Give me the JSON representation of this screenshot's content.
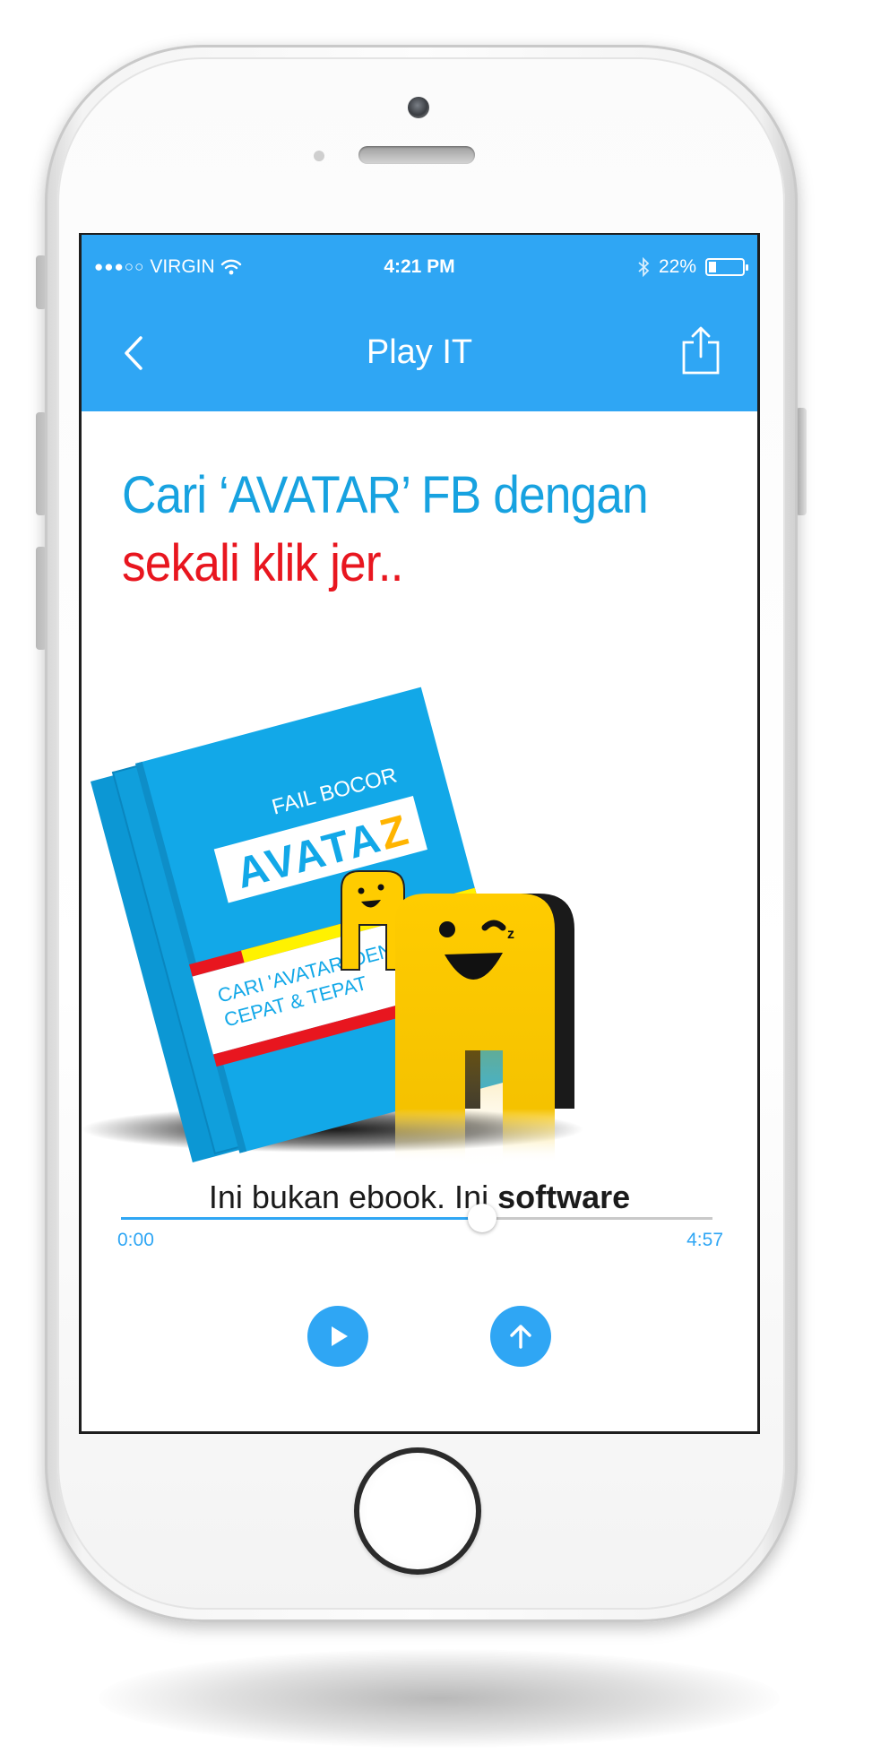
{
  "status_bar": {
    "signal": "●●●○○",
    "carrier": "VIRGIN",
    "time": "4:21 PM",
    "battery_percent": "22%",
    "battery_level": 0.22
  },
  "nav": {
    "title": "Play IT"
  },
  "headline": {
    "line1": "Cari ‘AVATAR’ FB dengan",
    "line2": "sekali klik jer.."
  },
  "hero": {
    "book_kicker": "FAIL BOCOR",
    "book_title_main": "AVATA",
    "book_title_accent": "Z",
    "book_tagline_1": "CARI 'AVATAR' DENGAN",
    "book_tagline_2": "CEPAT & TEPAT"
  },
  "caption": {
    "text": "Ini bukan ebook. Ini ",
    "emphasis": "software"
  },
  "player": {
    "current_time": "0:00",
    "total_time": "4:57",
    "progress_fraction": 0.61
  },
  "colors": {
    "accent": "#2fa6f4",
    "headline_blue": "#17a2e0",
    "headline_red": "#e8161f",
    "book_blue": "#12a8e8",
    "mascot_yellow": "#ffcc00"
  },
  "icons": {
    "back": "chevron-left-icon",
    "share": "share-icon",
    "wifi": "wifi-icon",
    "bluetooth": "bluetooth-icon",
    "play": "play-icon",
    "upload": "arrow-up-icon"
  }
}
